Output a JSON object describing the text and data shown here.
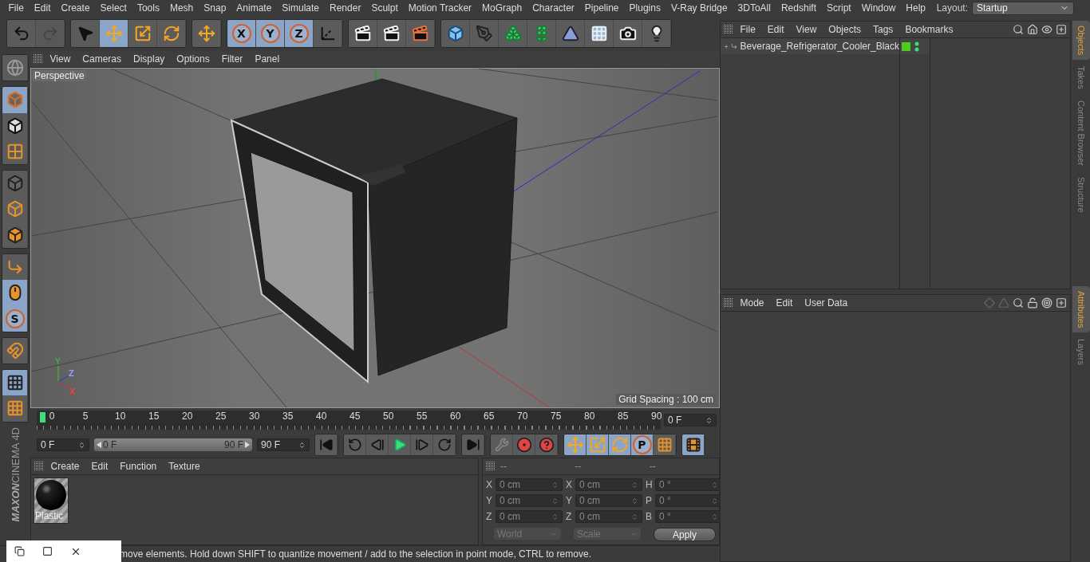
{
  "menu": [
    "File",
    "Edit",
    "Create",
    "Select",
    "Tools",
    "Mesh",
    "Snap",
    "Animate",
    "Simulate",
    "Render",
    "Sculpt",
    "Motion Tracker",
    "MoGraph",
    "Character",
    "Pipeline",
    "Plugins",
    "V-Ray Bridge",
    "3DToAll",
    "Redshift",
    "Script",
    "Window",
    "Help"
  ],
  "layout": {
    "label": "Layout:",
    "value": "Startup"
  },
  "toolbar": [
    [
      {
        "kind": "undo",
        "selected": false,
        "disabled": false
      },
      {
        "kind": "redo",
        "selected": false,
        "disabled": true
      }
    ],
    [
      {
        "kind": "select",
        "selected": false,
        "disabled": false
      },
      {
        "kind": "move",
        "selected": true,
        "disabled": false
      },
      {
        "kind": "scale",
        "selected": false,
        "disabled": false
      },
      {
        "kind": "rotate",
        "selected": false,
        "disabled": false
      }
    ],
    [
      {
        "kind": "move",
        "selected": false,
        "disabled": false
      }
    ],
    [
      {
        "kind": "axis",
        "label": "X",
        "selected": true,
        "disabled": false
      },
      {
        "kind": "axis",
        "label": "Y",
        "selected": true,
        "disabled": false
      },
      {
        "kind": "axis",
        "label": "Z",
        "selected": true,
        "disabled": false
      },
      {
        "kind": "coords",
        "selected": false,
        "disabled": false
      }
    ],
    [
      {
        "kind": "render-region",
        "selected": false,
        "disabled": false
      },
      {
        "kind": "render-view",
        "selected": false,
        "disabled": false
      },
      {
        "kind": "render-settings",
        "selected": false,
        "disabled": false
      }
    ],
    [
      {
        "kind": "cube",
        "selected": false,
        "disabled": false
      },
      {
        "kind": "pen",
        "selected": false,
        "disabled": false
      },
      {
        "kind": "subdivision",
        "selected": false,
        "disabled": false
      },
      {
        "kind": "cloner",
        "selected": false,
        "disabled": false
      },
      {
        "kind": "deformer",
        "selected": false,
        "disabled": false
      },
      {
        "kind": "floor",
        "selected": false,
        "disabled": false
      },
      {
        "kind": "camera",
        "selected": false,
        "disabled": false
      },
      {
        "kind": "light",
        "selected": false,
        "disabled": false
      }
    ]
  ],
  "side_tools": [
    [
      {
        "kind": "make-editable",
        "selected": false
      }
    ],
    [
      {
        "kind": "model",
        "selected": true
      },
      {
        "kind": "texture",
        "selected": false
      },
      {
        "kind": "workplane",
        "selected": false
      }
    ],
    [
      {
        "kind": "points",
        "selected": false
      },
      {
        "kind": "edges",
        "selected": false
      },
      {
        "kind": "polygons",
        "selected": false
      }
    ],
    [
      {
        "kind": "axis-mode",
        "selected": false
      },
      {
        "kind": "tweak",
        "selected": true
      },
      {
        "kind": "solo",
        "label": "S",
        "selected": true
      }
    ],
    [
      {
        "kind": "snap",
        "selected": false
      }
    ],
    [
      {
        "kind": "grid-lock",
        "selected": true
      },
      {
        "kind": "grid-rotate",
        "selected": false
      }
    ]
  ],
  "logo": {
    "brand": "MAXON",
    "product": "CINEMA 4D"
  },
  "viewport": {
    "menu": [
      "View",
      "Cameras",
      "Display",
      "Options",
      "Filter",
      "Panel"
    ],
    "camera": "Perspective",
    "grid_spacing": "Grid Spacing : 100 cm",
    "gizmo": [
      "Y",
      "Z",
      "X"
    ]
  },
  "timeline": {
    "ticks": [
      "0",
      "5",
      "10",
      "15",
      "20",
      "25",
      "30",
      "35",
      "40",
      "45",
      "50",
      "55",
      "60",
      "65",
      "70",
      "75",
      "80",
      "85",
      "90"
    ],
    "level": 0,
    "current": "0 F"
  },
  "transport": {
    "start": "0 F",
    "range_start": "0 F",
    "range_end": "90 F",
    "end": "90 F",
    "level": 1,
    "groups": [
      [
        {
          "kind": "go-start",
          "selected": false
        }
      ],
      [
        {
          "kind": "prev-key",
          "selected": false
        },
        {
          "kind": "prev-frame",
          "selected": false
        },
        {
          "kind": "play",
          "selected": false
        },
        {
          "kind": "next-frame",
          "selected": false
        },
        {
          "kind": "next-key",
          "selected": false
        }
      ],
      [
        {
          "kind": "go-end",
          "selected": false
        }
      ],
      [
        {
          "kind": "record",
          "selected": false
        },
        {
          "kind": "autokey",
          "selected": false
        },
        {
          "kind": "help",
          "selected": false
        }
      ],
      [
        {
          "kind": "move",
          "selected": true
        },
        {
          "kind": "scale",
          "selected": true
        },
        {
          "kind": "rotate",
          "selected": true
        },
        {
          "kind": "param",
          "label": "P",
          "selected": true
        },
        {
          "kind": "points-grid",
          "selected": false
        }
      ],
      [
        {
          "kind": "film",
          "selected": true
        }
      ]
    ]
  },
  "materials": {
    "menu": [
      "Create",
      "Edit",
      "Function",
      "Texture"
    ],
    "items": [
      {
        "name": "Plastic"
      }
    ]
  },
  "coordinates": {
    "headers": [
      "--",
      "--",
      "--"
    ],
    "disabled": true,
    "columns": [
      [
        {
          "axis": "X",
          "value": "0 cm"
        },
        {
          "axis": "Y",
          "value": "0 cm"
        },
        {
          "axis": "Z",
          "value": "0 cm"
        }
      ],
      [
        {
          "axis": "X",
          "value": "0 cm"
        },
        {
          "axis": "Y",
          "value": "0 cm"
        },
        {
          "axis": "Z",
          "value": "0 cm"
        }
      ],
      [
        {
          "axis": "H",
          "value": "0 °"
        },
        {
          "axis": "P",
          "value": "0 °"
        },
        {
          "axis": "B",
          "value": "0 °"
        }
      ]
    ],
    "dropdowns": [
      "World",
      "Scale"
    ],
    "apply": "Apply"
  },
  "status_bar": "move elements. Hold down SHIFT to quantize movement / add to the selection in point mode, CTRL to remove.",
  "objects": {
    "menu": [
      "File",
      "Edit",
      "View",
      "Objects",
      "Tags",
      "Bookmarks"
    ],
    "rows": [
      {
        "name": "Beverage_Refrigerator_Cooler_Black",
        "color": "#4ccc1e"
      }
    ]
  },
  "attributes": {
    "menu": [
      "Mode",
      "Edit",
      "User Data"
    ]
  },
  "side_tabs_top": [
    {
      "label": "Objects",
      "selected": true
    },
    {
      "label": "Takes",
      "selected": false
    },
    {
      "label": "Content Browser",
      "selected": false
    },
    {
      "label": "Structure",
      "selected": false
    }
  ],
  "side_tabs_bottom": [
    {
      "label": "Attributes",
      "selected": true
    },
    {
      "label": "Layers",
      "selected": false
    }
  ]
}
